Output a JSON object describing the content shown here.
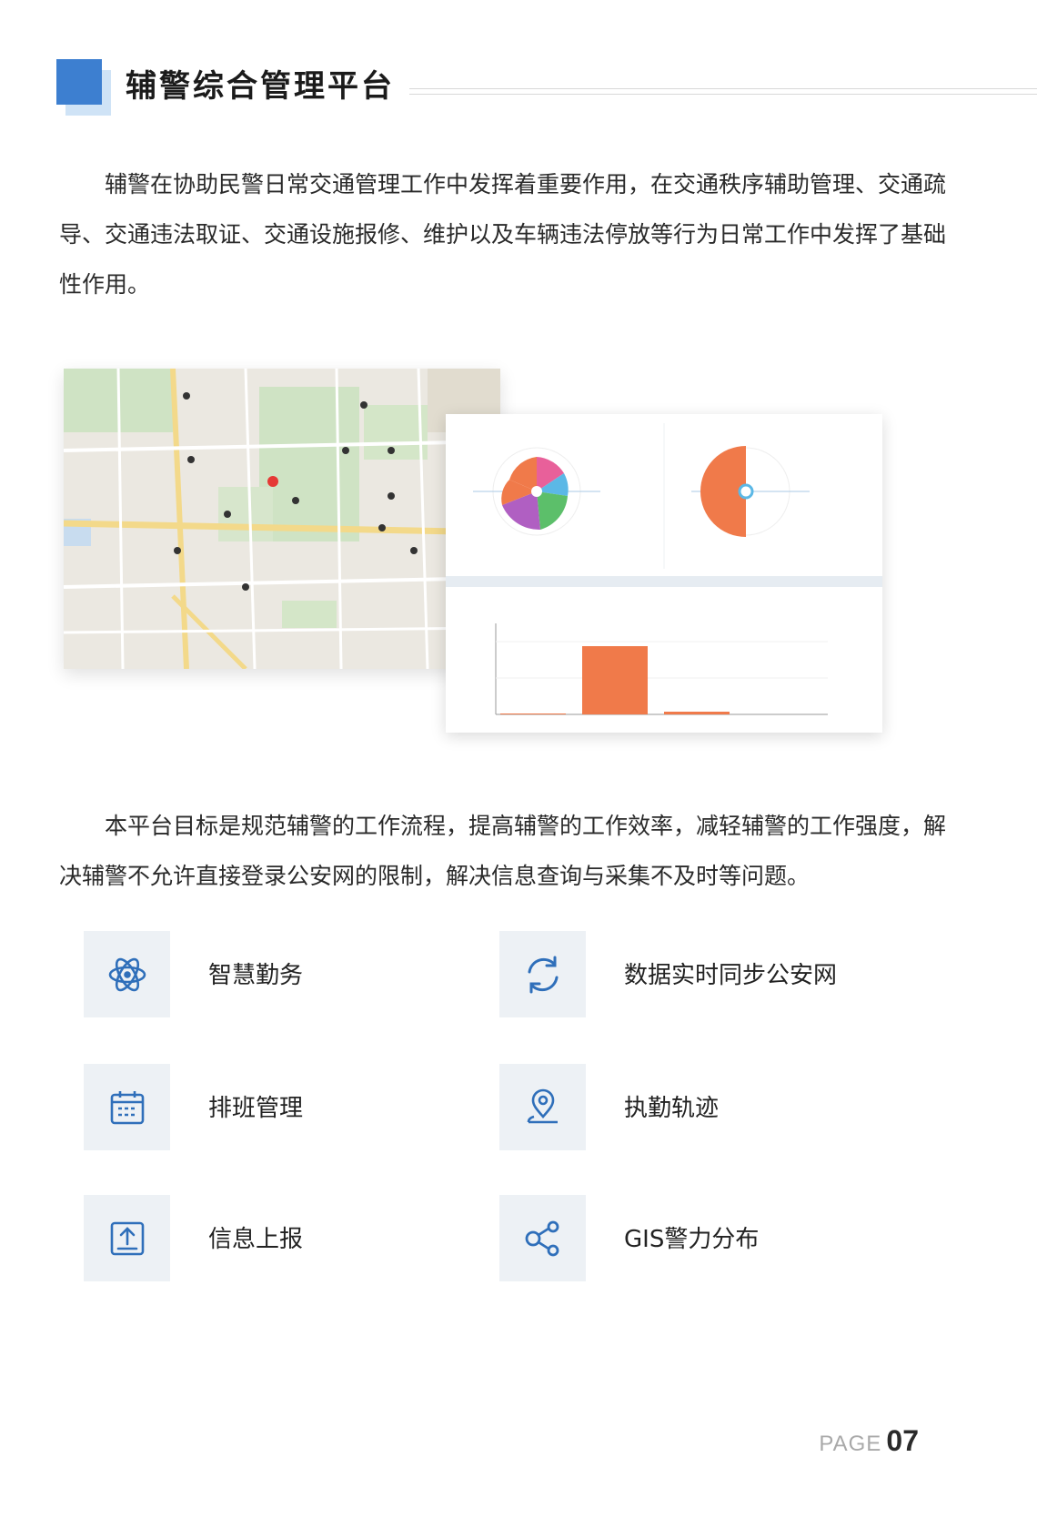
{
  "header": {
    "title": "辅警综合管理平台"
  },
  "intro_text": "辅警在协助民警日常交通管理工作中发挥着重要作用，在交通秩序辅助管理、交通疏导、交通违法取证、交通设施报修、维护以及车辆违法停放等行为日常工作中发挥了基础性作用。",
  "goal_text": "本平台目标是规范辅警的工作流程，提高辅警的工作效率，减轻辅警的工作强度，解决辅警不允许直接登录公安网的限制，解决信息查询与采集不及时等问题。",
  "features": [
    {
      "label": "智慧勤务",
      "icon": "atom-icon"
    },
    {
      "label": "数据实时同步公安网",
      "icon": "sync-icon"
    },
    {
      "label": "排班管理",
      "icon": "calendar-icon"
    },
    {
      "label": "执勤轨迹",
      "icon": "location-pin-icon"
    },
    {
      "label": "信息上报",
      "icon": "upload-icon"
    },
    {
      "label": "GIS警力分布",
      "icon": "share-nodes-icon"
    }
  ],
  "colors": {
    "accent": "#3d7fd0",
    "icon": "#2f6fba",
    "chart_bar": "#f07a4a",
    "icon_bg": "#edf1f5"
  },
  "page": {
    "word": "PAGE",
    "number": "07"
  }
}
